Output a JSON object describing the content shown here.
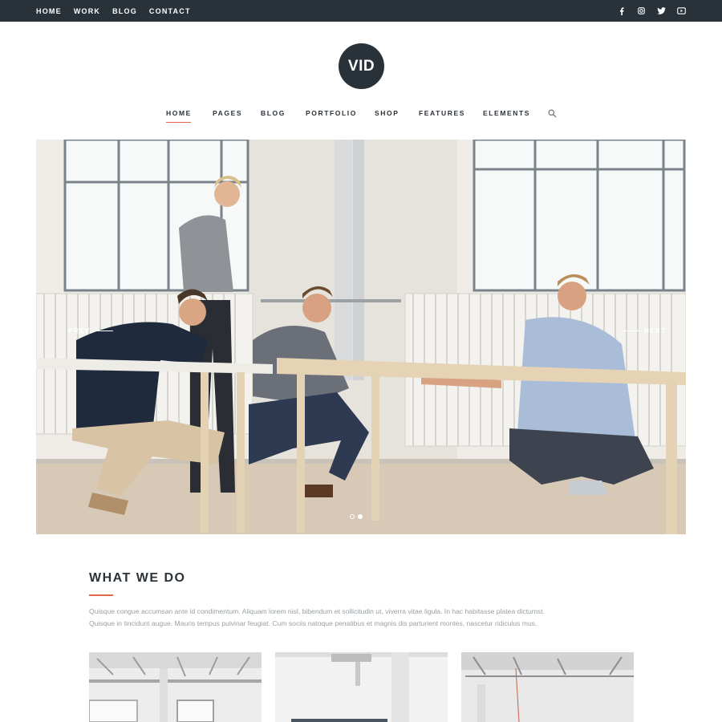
{
  "topbar": {
    "links": [
      "HOME",
      "WORK",
      "BLOG",
      "CONTACT"
    ],
    "social_icons": [
      "facebook-icon",
      "instagram-icon",
      "twitter-icon",
      "youtube-icon"
    ]
  },
  "logo": {
    "text": "VID"
  },
  "nav": {
    "items": [
      "HOME",
      "PAGES",
      "BLOG",
      "PORTFOLIO",
      "SHOP",
      "FEATURES",
      "ELEMENTS"
    ],
    "active": "HOME",
    "search_icon": "search-icon"
  },
  "hero": {
    "prev_label": "PREV",
    "next_label": "NEXT",
    "slide_count": 2,
    "active_slide": 2
  },
  "what_we_do": {
    "title": "WHAT WE DO",
    "line1": "Quisque congue accumsan ante id condimentum. Aliquam lorem nisl, bibendum et sollicitudin ut, viverra vitae ligula. In hac habitasse platea dictumst.",
    "line2": "Quisque in tincidunt augue. Mauris tempus pulvinar feugiat. Cum sociis natoque penatibus et magnis dis parturient montes, nascetur ridiculus mus."
  },
  "colors": {
    "dark": "#283238",
    "accent": "#e0654b",
    "muted_text": "#9aa0a4"
  }
}
